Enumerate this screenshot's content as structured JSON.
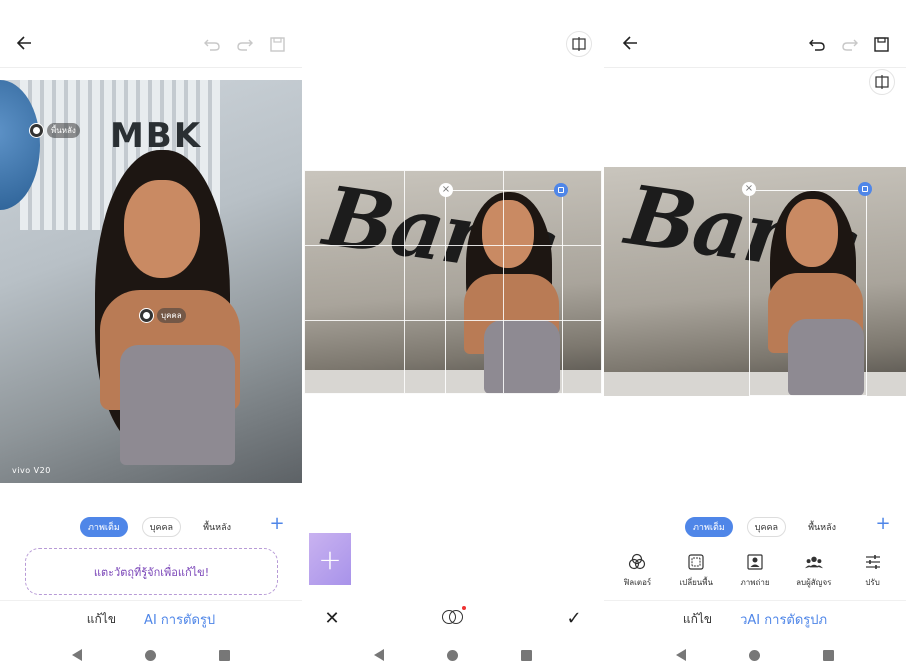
{
  "screen1": {
    "tags": {
      "background": "พื้นหลัง",
      "person": "บุคคล"
    },
    "watermark": "vivo V20",
    "building_sign": "MBK",
    "chips": [
      "ภาพเต็ม",
      "บุคคล",
      "พื้นหลัง"
    ],
    "hint": "แตะวัตถุที่รู้จักเพื่อแก้ไข!",
    "tabs": {
      "edit": "แก้ไข",
      "ai_cutout": "AI การตัดรูป"
    }
  },
  "screen2": {
    "sign_text": "Bang",
    "actions": {
      "cancel": "cancel-icon",
      "effects": "blend-icon",
      "confirm": "check-icon"
    }
  },
  "screen3": {
    "sign_text": "Bang",
    "chips": [
      "ภาพเต็ม",
      "บุคคล",
      "พื้นหลัง"
    ],
    "tools": [
      "ฟิลเตอร์",
      "เปลี่ยนพื้น",
      "ภาพถ่าย",
      "ลบผู้สัญจร",
      "ปรับ"
    ],
    "tabs": {
      "edit": "แก้ไข",
      "ai_cutout": "วAI การตัดรูปภ"
    }
  },
  "colors": {
    "accent": "#4f86e8",
    "hint_purple": "#7a45b8"
  }
}
